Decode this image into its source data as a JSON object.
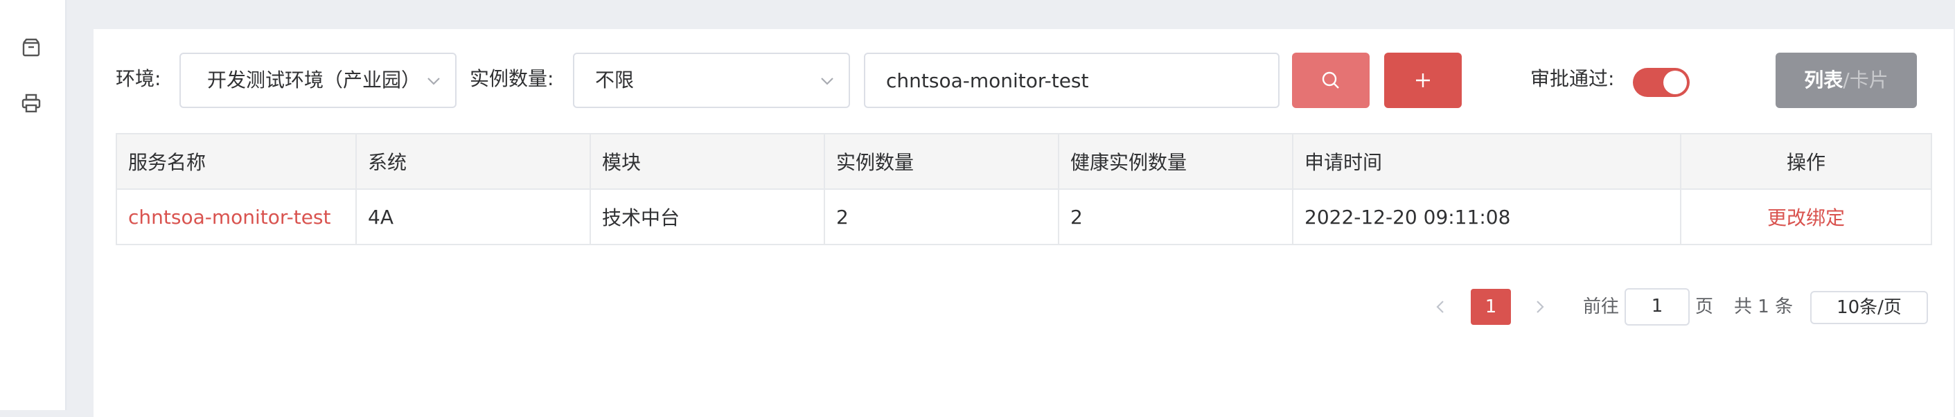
{
  "rail": {
    "icons": [
      "package-icon",
      "printer-icon"
    ]
  },
  "filters": {
    "env_label": "环境:",
    "env_value": "开发测试环境（产业园）",
    "count_label": "实例数量:",
    "count_value": "不限",
    "search_value": "chntsoa-monitor-test",
    "approve_label": "审批通过:",
    "approve_on": true,
    "view_toggle_a": "列表",
    "view_toggle_b": "/卡片"
  },
  "table": {
    "headers": [
      "服务名称",
      "系统",
      "模块",
      "实例数量",
      "健康实例数量",
      "申请时间",
      "操作"
    ],
    "rows": [
      {
        "service": "chntsoa-monitor-test",
        "system": "4A",
        "module": "技术中台",
        "instances": "2",
        "healthy": "2",
        "time": "2022-12-20 09:11:08",
        "action": "更改绑定"
      }
    ]
  },
  "pagination": {
    "current_page": "1",
    "goto_label": "前往",
    "goto_value": "1",
    "page_unit": "页",
    "total_text": "共 1 条",
    "page_size": "10条/页"
  },
  "colors": {
    "accent": "#d9534f",
    "search_button": "#e57373",
    "view_button": "#919399"
  }
}
